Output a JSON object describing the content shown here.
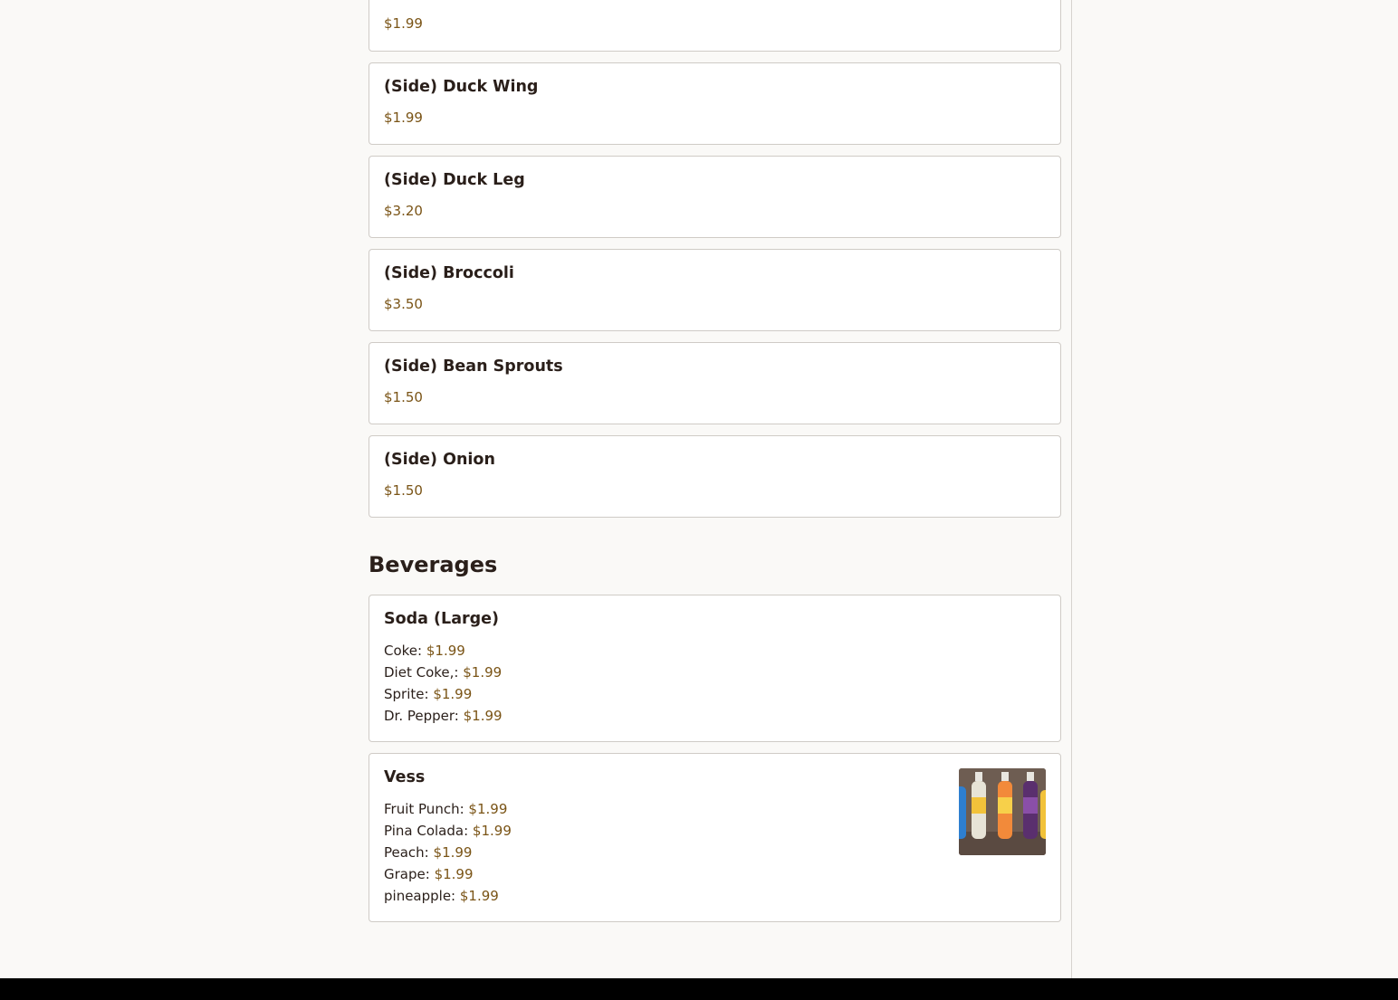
{
  "sides": [
    {
      "price": "$1.99"
    },
    {
      "name": "(Side) Duck Wing",
      "price": "$1.99"
    },
    {
      "name": "(Side) Duck Leg",
      "price": "$3.20"
    },
    {
      "name": "(Side) Broccoli",
      "price": "$3.50"
    },
    {
      "name": "(Side) Bean Sprouts",
      "price": "$1.50"
    },
    {
      "name": "(Side) Onion",
      "price": "$1.50"
    }
  ],
  "beverages": {
    "title": "Beverages",
    "soda": {
      "name": "Soda (Large)",
      "options": [
        {
          "label": "Coke:",
          "price": "$1.99"
        },
        {
          "label": "Diet Coke,:",
          "price": "$1.99"
        },
        {
          "label": "Sprite:",
          "price": "$1.99"
        },
        {
          "label": "Dr. Pepper:",
          "price": "$1.99"
        }
      ]
    },
    "vess": {
      "name": "Vess",
      "image_icon": "vess-bottles-photo",
      "options": [
        {
          "label": "Fruit Punch:",
          "price": "$1.99"
        },
        {
          "label": "Pina Colada:",
          "price": "$1.99"
        },
        {
          "label": "Peach:",
          "price": "$1.99"
        },
        {
          "label": "Grape:",
          "price": "$1.99"
        },
        {
          "label": "pineapple:",
          "price": "$1.99"
        }
      ]
    }
  },
  "colors": {
    "background": "#faf9f7",
    "price": "#7a5416",
    "text": "#2a1f1a",
    "card_border": "#cfcbc6",
    "footer": "#000000"
  }
}
